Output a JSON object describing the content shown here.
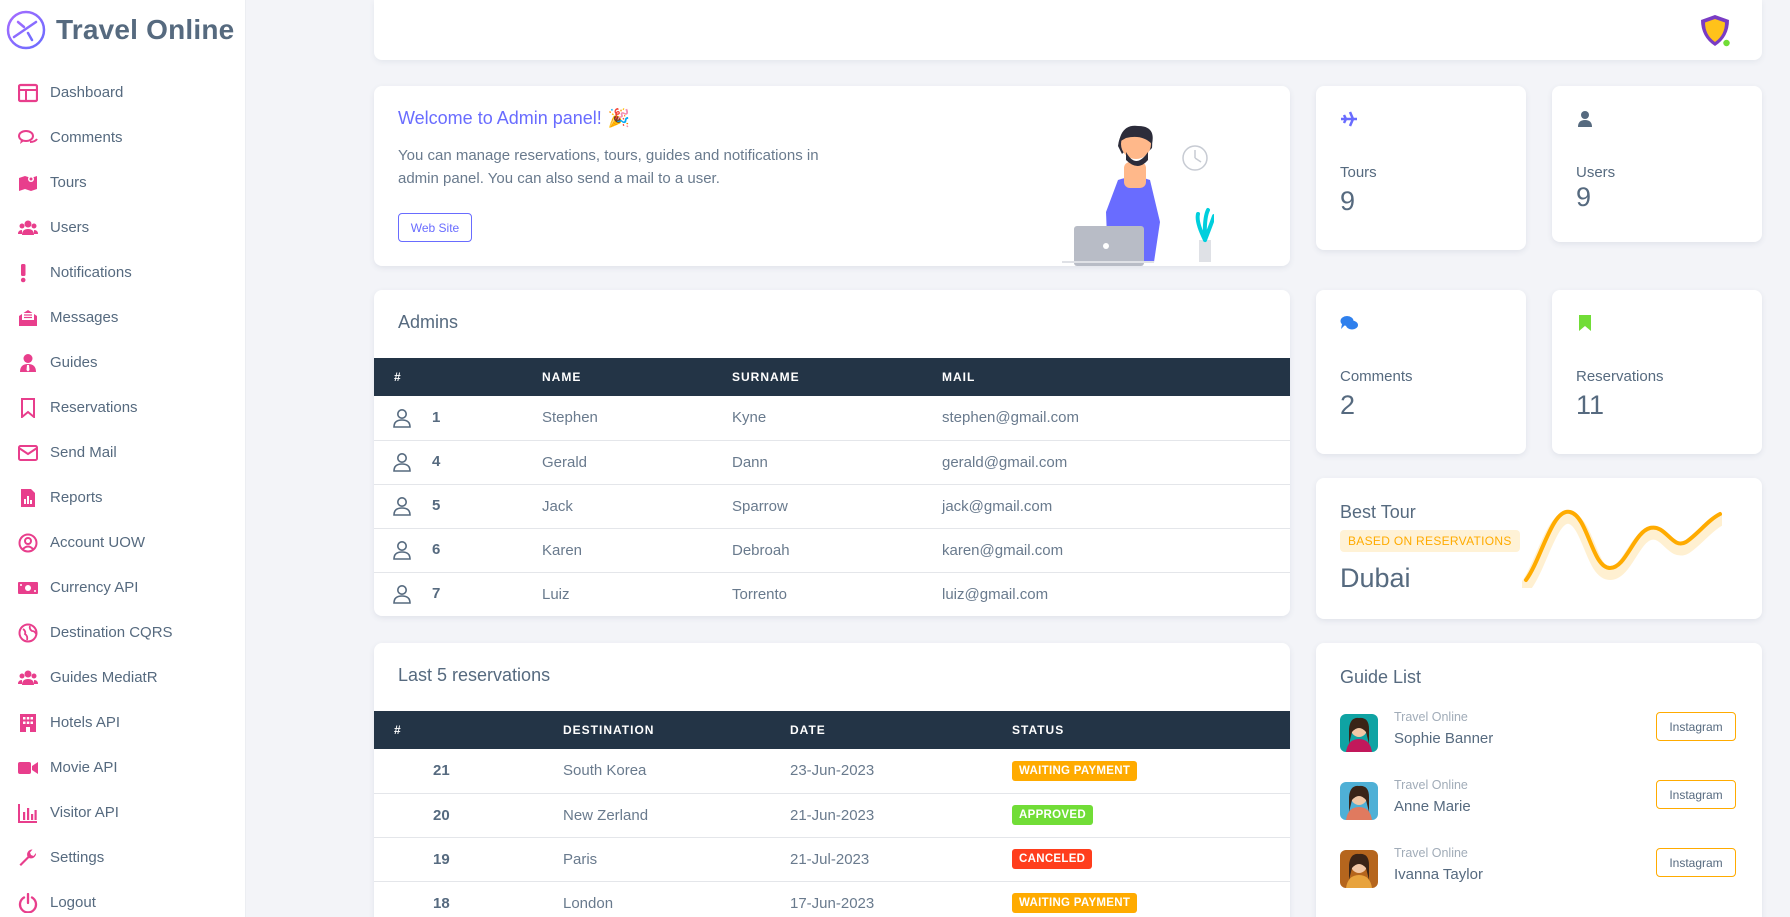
{
  "brand": {
    "title": "Travel Online",
    "logo_icon": "airplane-circle-icon"
  },
  "colors": {
    "accent": "#696cff",
    "nav_icon": "#e83e8c",
    "dark_header": "#233446",
    "warning": "#ffab00",
    "success": "#71dd37",
    "danger": "#ff3e1d"
  },
  "sidebar": {
    "items": [
      {
        "label": "Dashboard",
        "icon": "dashboard-icon"
      },
      {
        "label": "Comments",
        "icon": "comments-icon"
      },
      {
        "label": "Tours",
        "icon": "map-icon"
      },
      {
        "label": "Users",
        "icon": "users-icon"
      },
      {
        "label": "Notifications",
        "icon": "exclamation-icon"
      },
      {
        "label": "Messages",
        "icon": "envelope-open-icon"
      },
      {
        "label": "Guides",
        "icon": "user-tie-icon"
      },
      {
        "label": "Reservations",
        "icon": "bookmark-icon"
      },
      {
        "label": "Send Mail",
        "icon": "envelope-icon"
      },
      {
        "label": "Reports",
        "icon": "report-file-icon"
      },
      {
        "label": "Account UOW",
        "icon": "user-circle-icon"
      },
      {
        "label": "Currency API",
        "icon": "money-bill-icon"
      },
      {
        "label": "Destination CQRS",
        "icon": "globe-icon"
      },
      {
        "label": "Guides MediatR",
        "icon": "users-icon"
      },
      {
        "label": "Hotels API",
        "icon": "hotel-icon"
      },
      {
        "label": "Movie API",
        "icon": "video-icon"
      },
      {
        "label": "Visitor API",
        "icon": "bar-chart-icon"
      },
      {
        "label": "Settings",
        "icon": "wrench-icon"
      },
      {
        "label": "Logout",
        "icon": "power-icon"
      }
    ]
  },
  "topbar": {
    "shield_icon": "shield-icon"
  },
  "welcome": {
    "title": "Welcome to Admin panel!",
    "emoji": "🎉",
    "text": "You can manage reservations, tours, guides and notifications in admin panel. You can also send a mail to a user.",
    "button_label": "Web Site"
  },
  "stats": {
    "tours": {
      "label": "Tours",
      "value": "9",
      "icon": "plane-icon"
    },
    "users": {
      "label": "Users",
      "value": "9",
      "icon": "user-icon"
    },
    "comments": {
      "label": "Comments",
      "value": "2",
      "icon": "comments-icon"
    },
    "reservations": {
      "label": "Reservations",
      "value": "11",
      "icon": "bookmark-icon"
    }
  },
  "admins": {
    "title": "Admins",
    "headers": [
      "#",
      "NAME",
      "SURNAME",
      "MAIL"
    ],
    "rows": [
      {
        "id": "1",
        "name": "Stephen",
        "surname": "Kyne",
        "mail": "stephen@gmail.com"
      },
      {
        "id": "4",
        "name": "Gerald",
        "surname": "Dann",
        "mail": "gerald@gmail.com"
      },
      {
        "id": "5",
        "name": "Jack",
        "surname": "Sparrow",
        "mail": "jack@gmail.com"
      },
      {
        "id": "6",
        "name": "Karen",
        "surname": "Debroah",
        "mail": "karen@gmail.com"
      },
      {
        "id": "7",
        "name": "Luiz",
        "surname": "Torrento",
        "mail": "luiz@gmail.com"
      }
    ]
  },
  "best_tour": {
    "title": "Best Tour",
    "badge": "BASED ON RESERVATIONS",
    "value": "Dubai"
  },
  "reservations": {
    "title": "Last 5 reservations",
    "headers": [
      "#",
      "DESTINATION",
      "DATE",
      "STATUS"
    ],
    "rows": [
      {
        "id": "21",
        "destination": "South Korea",
        "date": "23-Jun-2023",
        "status": "WAITING PAYMENT",
        "status_color": "#ffab00"
      },
      {
        "id": "20",
        "destination": "New Zerland",
        "date": "21-Jun-2023",
        "status": "APPROVED",
        "status_color": "#71dd37"
      },
      {
        "id": "19",
        "destination": "Paris",
        "date": "21-Jul-2023",
        "status": "CANCELED",
        "status_color": "#ff3e1d"
      },
      {
        "id": "18",
        "destination": "London",
        "date": "17-Jun-2023",
        "status": "WAITING PAYMENT",
        "status_color": "#ffab00"
      }
    ]
  },
  "guides": {
    "title": "Guide List",
    "items": [
      {
        "company": "Travel Online",
        "name": "Sophie Banner",
        "button": "Instagram"
      },
      {
        "company": "Travel Online",
        "name": "Anne Marie",
        "button": "Instagram"
      },
      {
        "company": "Travel Online",
        "name": "Ivanna Taylor",
        "button": "Instagram"
      }
    ]
  }
}
